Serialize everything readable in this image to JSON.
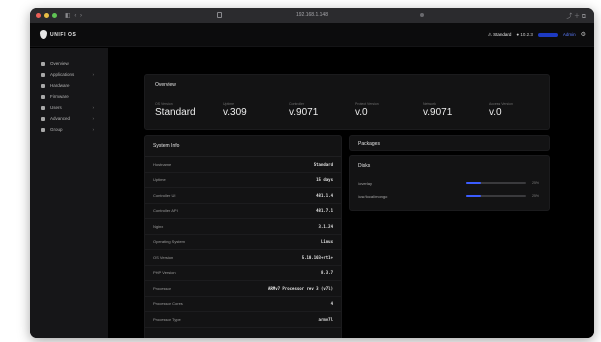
{
  "chrome": {
    "nav": "◧ ‹ ›",
    "url": "192.168.1.148",
    "right": "⤴ ＋ ⧉"
  },
  "header": {
    "logo": "UNIFI OS",
    "warning": "⚠ Standard",
    "version": "● 10.2.3",
    "button": "",
    "user": "Admin",
    "icon": "⚙"
  },
  "sidebar": {
    "items": [
      {
        "label": "Overview",
        "chevron": ""
      },
      {
        "label": "Applications",
        "chevron": "›"
      },
      {
        "label": "Hardware",
        "chevron": ""
      },
      {
        "label": "Firmware",
        "chevron": ""
      },
      {
        "label": "Users",
        "chevron": "›"
      },
      {
        "label": "Advanced",
        "chevron": "›"
      },
      {
        "label": "Group",
        "chevron": "›"
      }
    ]
  },
  "overview": {
    "title": "Overview",
    "stats": [
      {
        "label": "OS Version",
        "value": "Standard"
      },
      {
        "label": "Uptime",
        "value": "v.309"
      },
      {
        "label": "Controller",
        "value": "v.9071"
      },
      {
        "label": "Protect Version",
        "value": "v.0"
      },
      {
        "label": "Network",
        "value": "v.9071"
      },
      {
        "label": "Access Version",
        "value": "v.0"
      }
    ]
  },
  "system_info": {
    "title": "System Info",
    "rows": [
      {
        "label": "Hostname",
        "value": "Standard"
      },
      {
        "label": "Uptime",
        "value": "15 days"
      },
      {
        "label": "Controller UI",
        "value": "481.1.4"
      },
      {
        "label": "Controller API",
        "value": "481.7.1"
      },
      {
        "label": "Nginx",
        "value": "3.1.24"
      },
      {
        "label": "Operating System",
        "value": "Linux"
      },
      {
        "label": "OS Version",
        "value": "5.10.103+rt1+"
      },
      {
        "label": "PHP Version",
        "value": "8.3.7"
      },
      {
        "label": "Processor",
        "value": "ARMv7 Processor rev 3 (v7l)"
      },
      {
        "label": "Processor Cores",
        "value": "4"
      },
      {
        "label": "Processor Type",
        "value": "armv7l"
      }
    ]
  },
  "packages": {
    "title": "Packages"
  },
  "disks": {
    "title": "Disks",
    "rows": [
      {
        "name": "/overlay",
        "fill": 0.25,
        "value": "25%"
      },
      {
        "name": "/usr/local/mongo",
        "fill": 0.25,
        "value": "25%"
      }
    ]
  },
  "colors": {
    "accent": "#3b5cff",
    "background": "#000000",
    "card": "#131314",
    "sidebar": "#161618"
  }
}
